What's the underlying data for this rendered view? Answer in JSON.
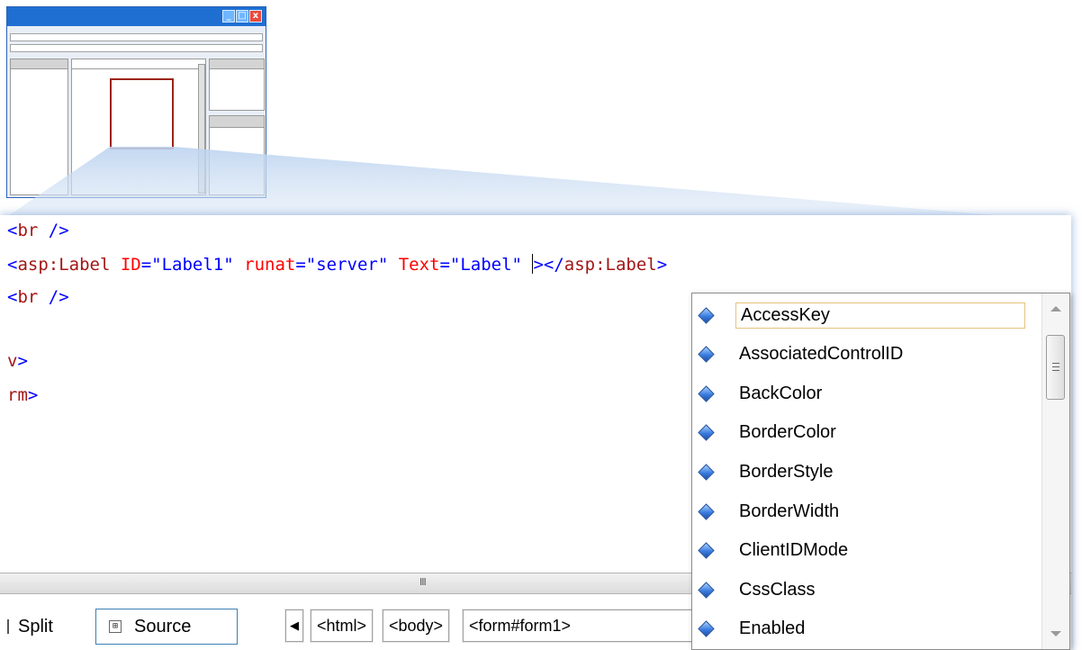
{
  "thumbnail": {
    "window_buttons": [
      "_",
      "□",
      "x"
    ]
  },
  "code_lines": [
    {
      "parts": [
        [
          "punct",
          "<"
        ],
        [
          "tag",
          "br"
        ],
        [
          "punct",
          " />"
        ]
      ]
    },
    {
      "parts": [
        [
          "punct",
          "<"
        ],
        [
          "tag",
          "asp:Label"
        ],
        [
          "attr",
          " ID"
        ],
        [
          "punct",
          "=\"Label1\""
        ],
        [
          "attr",
          " runat"
        ],
        [
          "punct",
          "=\"server\""
        ],
        [
          "attr",
          " Text"
        ],
        [
          "punct",
          "=\"Label\" "
        ],
        [
          "caret",
          ""
        ],
        [
          "punct",
          "></"
        ],
        [
          "tag",
          "asp:Label"
        ],
        [
          "punct",
          ">"
        ]
      ]
    },
    {
      "parts": [
        [
          "punct",
          "<"
        ],
        [
          "tag",
          "br"
        ],
        [
          "punct",
          " />"
        ]
      ]
    },
    {
      "parts": []
    },
    {
      "parts": [
        [
          "tag",
          "v"
        ],
        [
          "punct",
          ">"
        ]
      ]
    },
    {
      "parts": [
        [
          "tag",
          "rm"
        ],
        [
          "punct",
          ">"
        ]
      ]
    }
  ],
  "hscroll": {
    "grip": "III"
  },
  "tabs": {
    "split": "Split",
    "source_icon": "⊞",
    "source": "Source"
  },
  "breadcrumbs": {
    "back": "◀",
    "items": [
      "<html>",
      "<body>",
      "<form#form1>"
    ]
  },
  "intellisense": {
    "items": [
      "AccessKey",
      "AssociatedControlID",
      "BackColor",
      "BorderColor",
      "BorderStyle",
      "BorderWidth",
      "ClientIDMode",
      "CssClass",
      "Enabled"
    ],
    "selected_index": 0,
    "item_icon": "property-diamond-icon"
  },
  "colors": {
    "tag": "#a31515",
    "attribute": "#ff0000",
    "value": "#0000ff",
    "accent": "#1f6fd2"
  }
}
